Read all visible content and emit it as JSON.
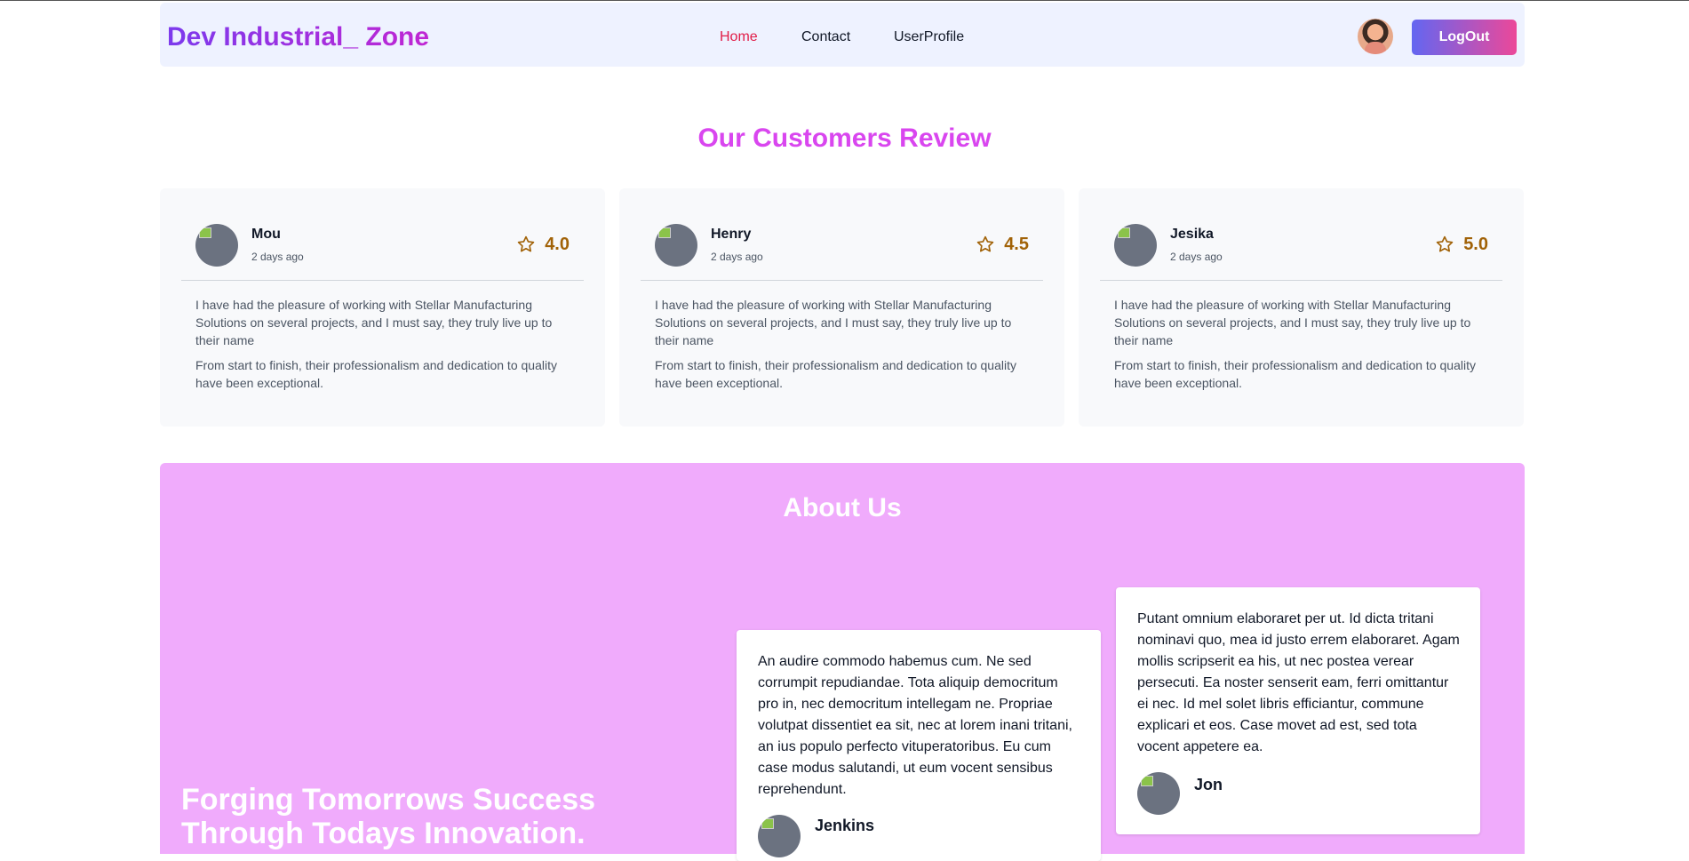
{
  "header": {
    "brand": "Dev Industrial_ Zone",
    "nav": [
      "Home",
      "Contact",
      "UserProfile"
    ],
    "logout_label": "LogOut"
  },
  "reviews": {
    "title": "Our Customers Review",
    "items": [
      {
        "name": "Mou",
        "time": "2 days ago",
        "rating": "4.0",
        "text1": "I have had the pleasure of working with Stellar Manufacturing Solutions on several projects, and I must say, they truly live up to their name",
        "text2": "From start to finish, their professionalism and dedication to quality have been exceptional."
      },
      {
        "name": "Henry",
        "time": "2 days ago",
        "rating": "4.5",
        "text1": "I have had the pleasure of working with Stellar Manufacturing Solutions on several projects, and I must say, they truly live up to their name",
        "text2": "From start to finish, their professionalism and dedication to quality have been exceptional."
      },
      {
        "name": "Jesika",
        "time": "2 days ago",
        "rating": "5.0",
        "text1": "I have had the pleasure of working with Stellar Manufacturing Solutions on several projects, and I must say, they truly live up to their name",
        "text2": "From start to finish, their professionalism and dedication to quality have been exceptional."
      }
    ]
  },
  "about": {
    "title": "About Us",
    "headline": "Forging Tomorrows Success Through Todays Innovation.",
    "testimonials": [
      {
        "name": "Jenkins",
        "text": "An audire commodo habemus cum. Ne sed corrumpit repudiandae. Tota aliquip democritum pro in, nec democritum intellegam ne. Propriae volutpat dissentiet ea sit, nec at lorem inani tritani, an ius populo perfecto vituperatoribus. Eu cum case modus salutandi, ut eum vocent sensibus reprehendunt."
      },
      {
        "name": "Jon",
        "text": "Putant omnium elaboraret per ut. Id dicta tritani nominavi quo, mea id justo errem elaboraret. Agam mollis scripserit ea his, ut nec postea verear persecuti. Ea noster senserit eam, ferri omittantur ei nec. Id mel solet libris efficiantur, commune explicari et eos. Case movet ad est, sed tota vocent appetere ea."
      }
    ]
  },
  "icons": {
    "star": "star-outline-icon",
    "avatar": "user-avatar"
  },
  "colors": {
    "brand_from": "#7c3aed",
    "brand_to": "#c026d3",
    "active_nav": "#e11d48",
    "about_bg": "#f0abfc",
    "rating": "#a16207"
  }
}
